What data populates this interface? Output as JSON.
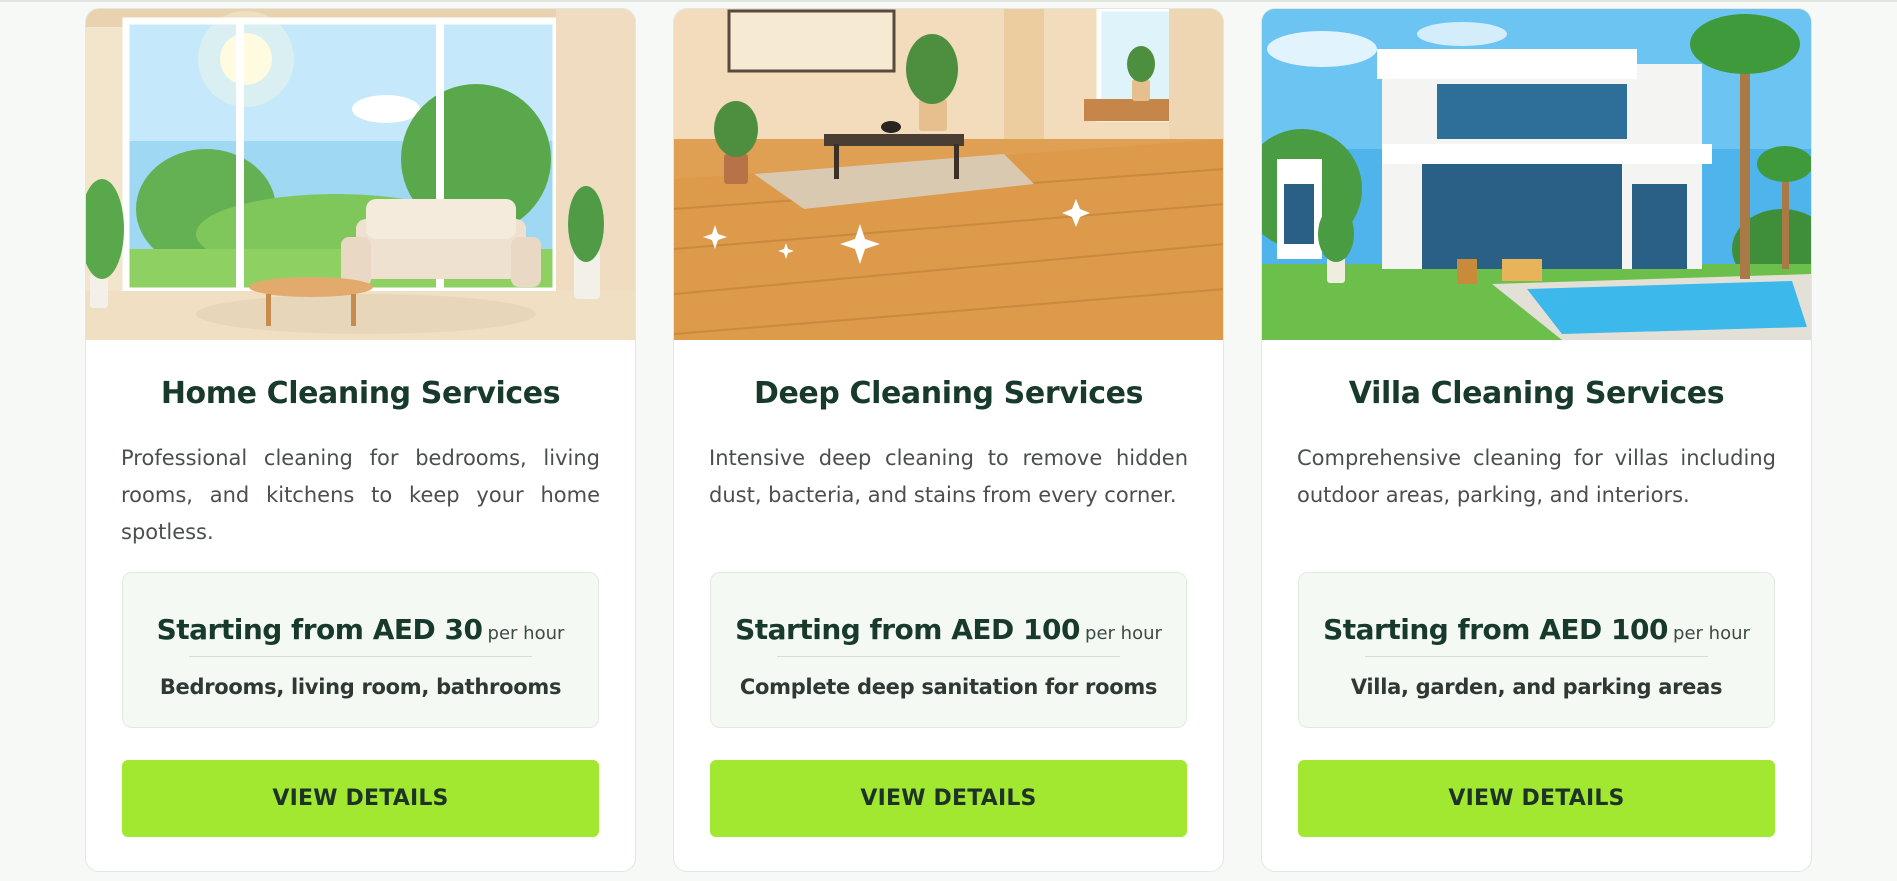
{
  "cards": [
    {
      "title": "Home Cleaning Services",
      "description": "Professional cleaning for bedrooms, living rooms, and kitchens to keep your home spotless.",
      "price_main": "Starting from AED 30",
      "price_unit": "per hour",
      "price_note": "Bedrooms, living room, bathrooms",
      "button_label": "VIEW DETAILS"
    },
    {
      "title": "Deep Cleaning Services",
      "description": "Intensive deep cleaning to remove hidden dust, bacteria, and stains from every corner.",
      "price_main": "Starting from AED 100",
      "price_unit": "per hour",
      "price_note": "Complete deep sanitation for rooms",
      "button_label": "VIEW DETAILS"
    },
    {
      "title": "Villa Cleaning Services",
      "description": "Comprehensive cleaning for villas including outdoor areas, parking, and interiors.",
      "price_main": "Starting from AED 100",
      "price_unit": "per hour",
      "price_note": "Villa, garden, and parking areas",
      "button_label": "VIEW DETAILS"
    }
  ],
  "colors": {
    "button_bg": "#a2e831",
    "title_text": "#183a2c",
    "price_box_bg": "#f4f9f4"
  }
}
